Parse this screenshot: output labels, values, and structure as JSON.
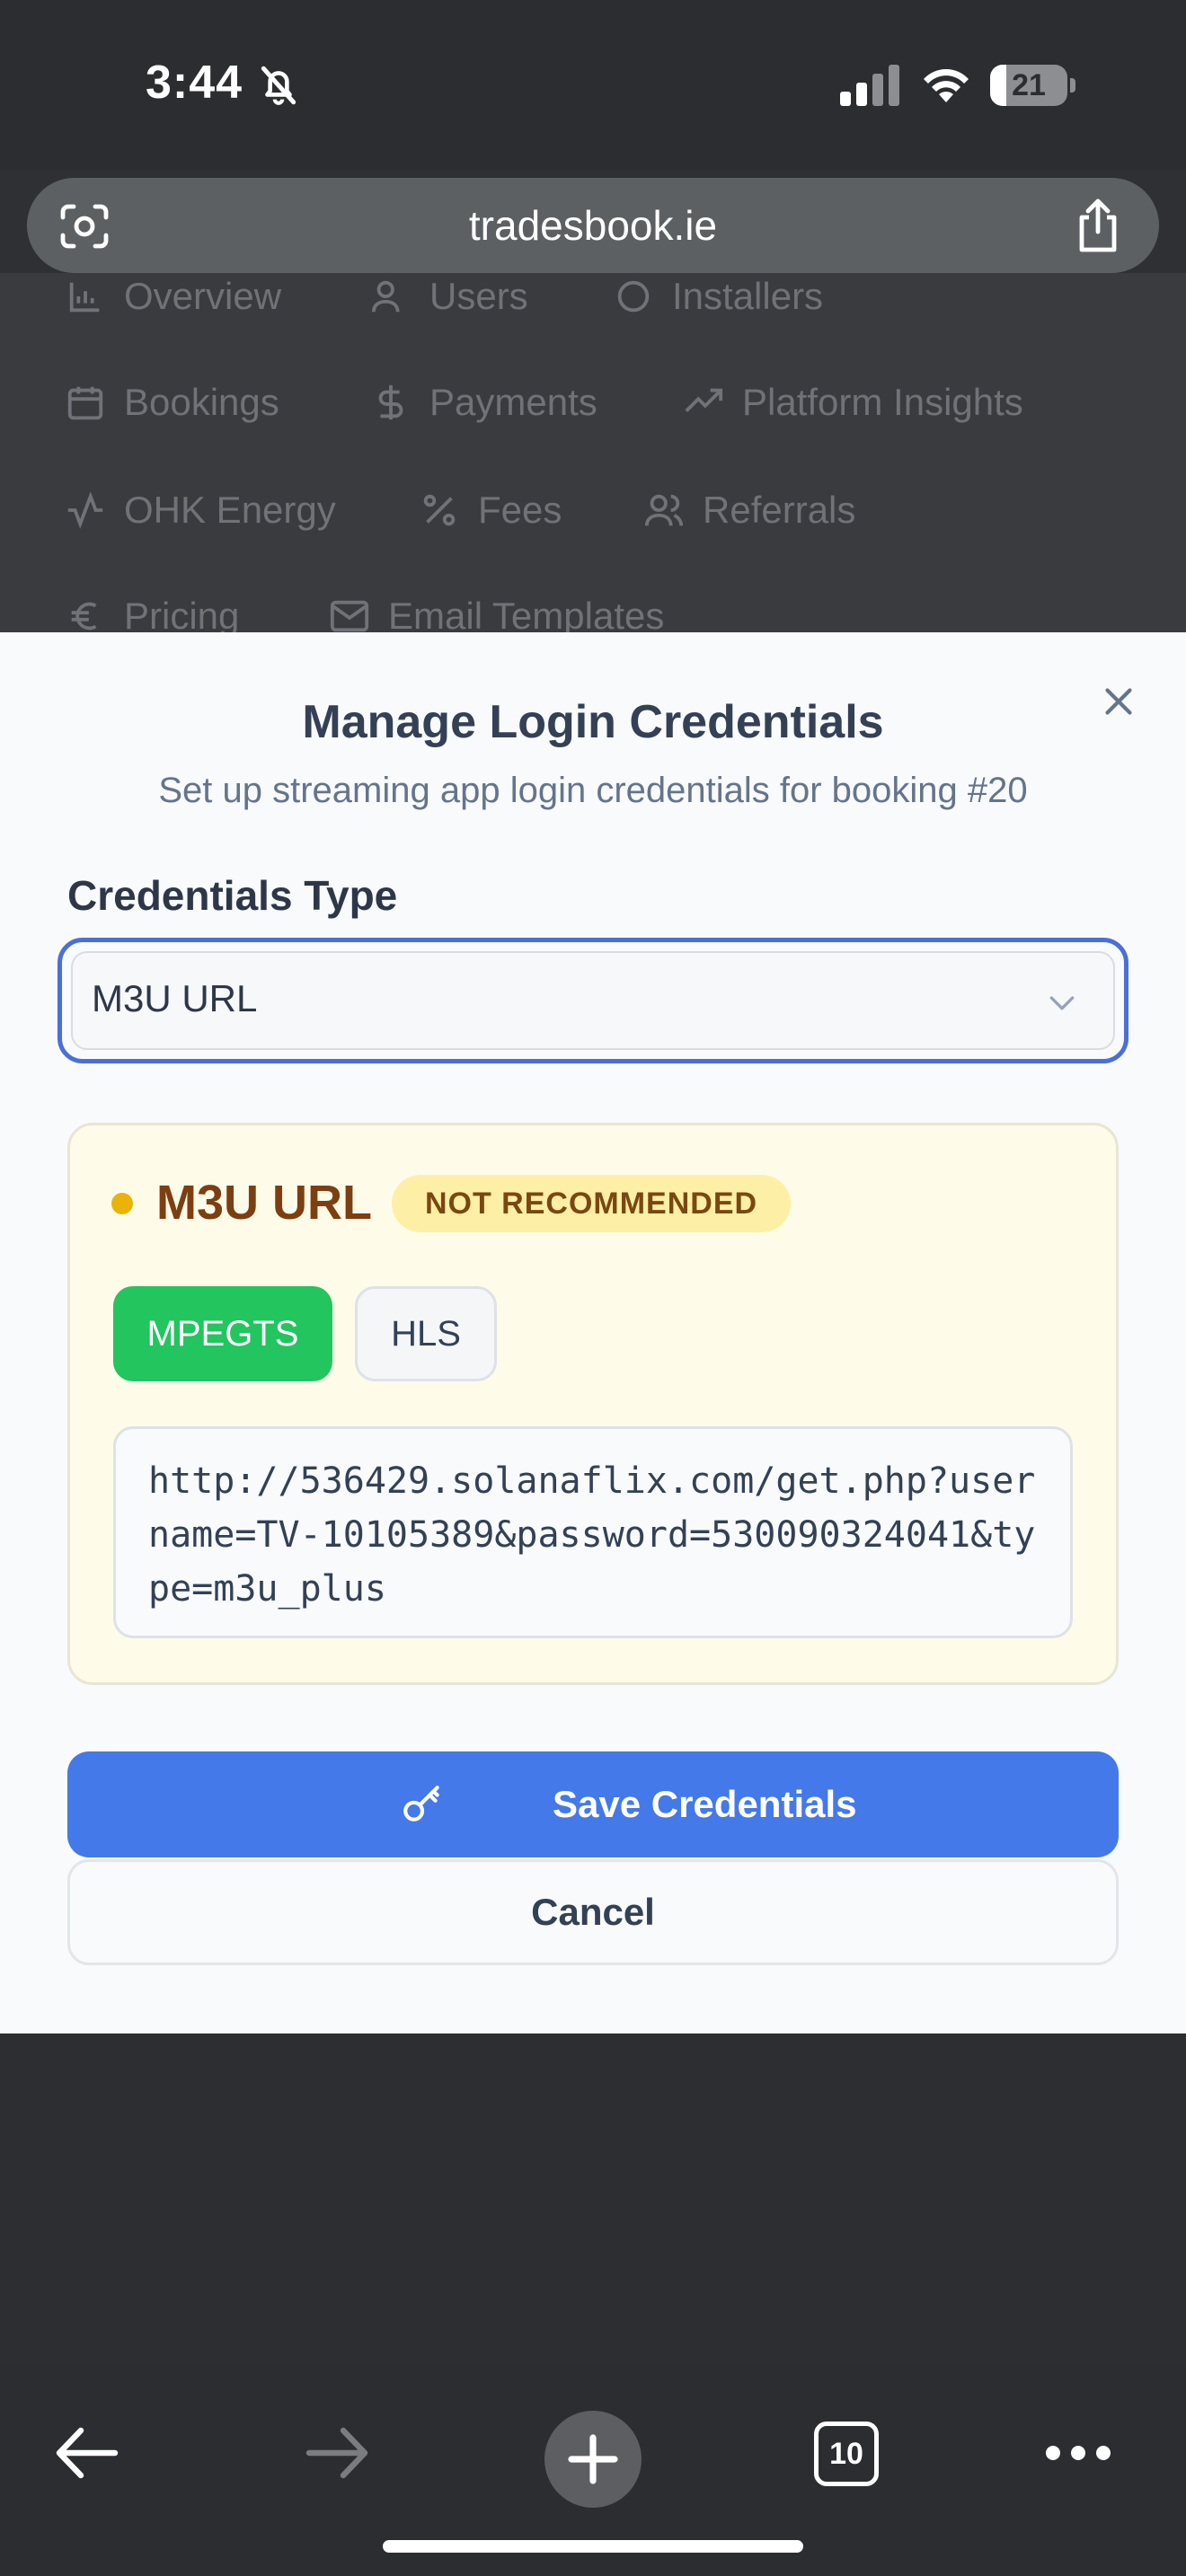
{
  "status_bar": {
    "time": "3:44",
    "battery": "21",
    "battery_level": 0.21
  },
  "browser": {
    "url": "tradesbook.ie",
    "tab_count": "10"
  },
  "background_nav": {
    "items": [
      "Overview",
      "Users",
      "Installers",
      "Bookings",
      "Payments",
      "Platform Insights",
      "OHK Energy",
      "Fees",
      "Referrals",
      "Pricing",
      "Email Templates"
    ]
  },
  "modal": {
    "title": "Manage Login Credentials",
    "subtitle": "Set up streaming app login credentials for booking #20",
    "field_label": "Credentials Type",
    "selected_type": "M3U URL",
    "card": {
      "title": "M3U URL",
      "badge": "NOT RECOMMENDED",
      "format_options": [
        "MPEGTS",
        "HLS"
      ],
      "selected_format": "MPEGTS",
      "url_value": "http://536429.solanaflix.com/get.php?username=TV-10105389&password=530090324041&type=m3u_plus"
    },
    "save_label": "Save Credentials",
    "cancel_label": "Cancel"
  },
  "colors": {
    "accent": "#4479ea",
    "select_focus": "#4a6fd8",
    "success": "#22c55e",
    "warning_dot": "#eab308",
    "warning_bg": "#fefce8",
    "badge_bg": "#fdf0a6"
  },
  "icons": [
    "bell-off-icon",
    "signal-icon",
    "wifi-icon",
    "battery-icon",
    "lens-icon",
    "share-icon",
    "close-icon",
    "chevron-down-icon",
    "key-icon",
    "back-icon",
    "forward-icon",
    "plus-icon",
    "tabs-icon",
    "more-icon"
  ]
}
